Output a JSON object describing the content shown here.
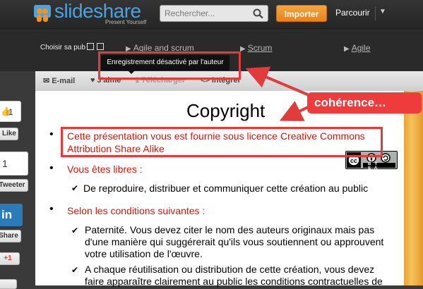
{
  "header": {
    "logo_text": "slideshare",
    "logo_tagline": "Present Yourself",
    "search_placeholder": "Rechercher...",
    "import_label": "Importer",
    "browse_label": "Parcourir"
  },
  "subbar": {
    "ad_choice_label": "Choisir sa pub",
    "related_links": [
      "Agile and scrum",
      "Scrum",
      "Agile"
    ]
  },
  "toolbar": {
    "email_label": "E-mail",
    "like_label": "J'aime",
    "download_label": "Télécharger",
    "embed_label": "Intégrer",
    "tooltip": "Enregistrement désactivé par l'auteur"
  },
  "slide": {
    "title": "Copyright",
    "license_line1": "Cette présentation vous est fournie sous licence Creative Commons",
    "license_line2": "Attribution Share Alike",
    "cc_badge_text": "BY SA",
    "free_heading": "Vous êtes libres :",
    "free_item": "De reproduire, distribuer et communiquer cette création au public",
    "conditions_heading": "Selon les conditions suivantes :",
    "paternity_line1": "Paternité. Vous devez citer le nom des auteurs originaux mais pas",
    "paternity_line2": "d'une manière qui suggérerait qu'ils vous soutiennent ou approuvent",
    "paternity_line3": "votre utilisation de l'œuvre.",
    "reuse_line1": "A chaque réutilisation ou distribution de cette création, vous devez",
    "reuse_line2": "faire apparaître clairement au public les conditions contractuelles de"
  },
  "share": {
    "fb_count": "1",
    "fb_label": "Like",
    "tweet_count": "1",
    "tweet_label": "Tweeter",
    "linkedin_logo": "in",
    "linkedin_label": "Share",
    "gplus_label": "+1"
  },
  "annotation": {
    "callout_text": "cohérence…"
  },
  "colors": {
    "accent_orange": "#f39327",
    "annotation_red": "#e23b3b",
    "slide_red": "#d1170a",
    "logo_blue": "#4aa3df"
  }
}
